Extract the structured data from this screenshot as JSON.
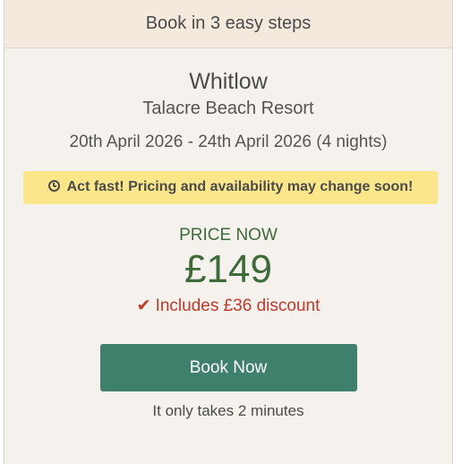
{
  "header": {
    "title": "Book in 3 easy steps"
  },
  "booking": {
    "park_name": "Whitlow",
    "resort_name": "Talacre Beach Resort",
    "dates": "20th April 2026 - 24th April 2026 (4 nights)"
  },
  "alert": {
    "icon": "clock-icon",
    "text": "Act fast! Pricing and availability may change soon!",
    "background": "#fbe68a"
  },
  "pricing": {
    "label": "PRICE NOW",
    "price": "£149",
    "discount_icon": "checkmark-icon",
    "discount_text": "Includes £36 discount",
    "price_color": "#3d6b3a",
    "discount_color": "#c0392b"
  },
  "cta": {
    "button_label": "Book Now",
    "note": "It only takes 2 minutes",
    "button_color": "#3e806b"
  }
}
